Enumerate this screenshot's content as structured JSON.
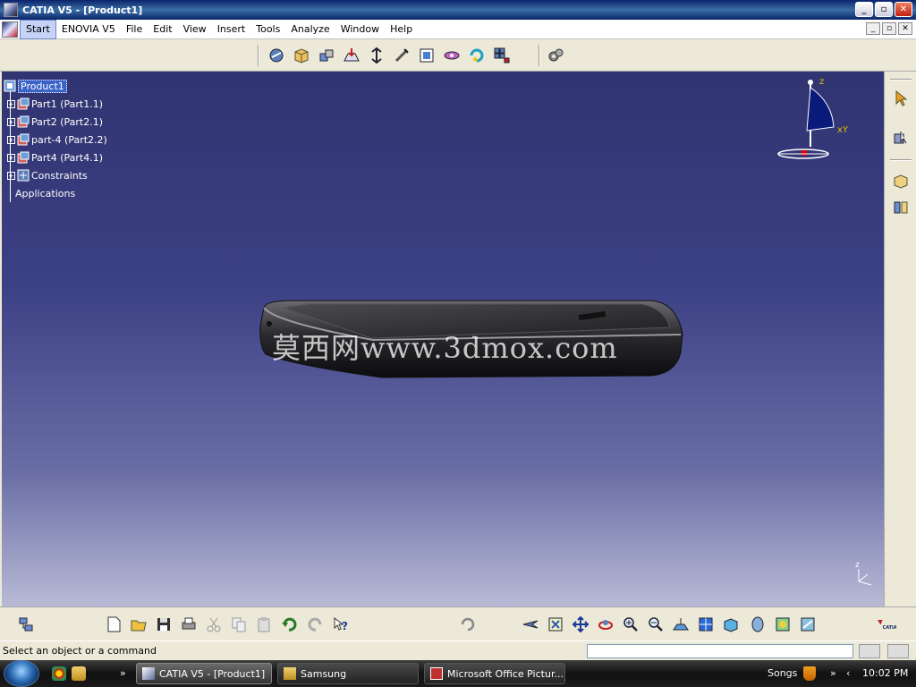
{
  "window": {
    "title": "CATIA V5 - [Product1]"
  },
  "menu": {
    "items": [
      {
        "label": "Start",
        "active": true
      },
      {
        "label": "ENOVIA V5"
      },
      {
        "label": "File"
      },
      {
        "label": "Edit"
      },
      {
        "label": "View"
      },
      {
        "label": "Insert"
      },
      {
        "label": "Tools"
      },
      {
        "label": "Analyze"
      },
      {
        "label": "Window"
      },
      {
        "label": "Help"
      }
    ]
  },
  "tree": {
    "root": "Product1",
    "items": [
      {
        "label": "Part1 (Part1.1)"
      },
      {
        "label": "Part2 (Part2.1)"
      },
      {
        "label": "part-4 (Part2.2)"
      },
      {
        "label": "Part4 (Part4.1)"
      },
      {
        "label": "Constraints"
      },
      {
        "label": "Applications"
      }
    ]
  },
  "viewport": {
    "watermark": "莫西网www.3dmox.com",
    "compass_labels": {
      "z": "z",
      "xy": "xY"
    },
    "mini_axis_label": "z"
  },
  "status": {
    "message": "Select an object or a command",
    "command_value": ""
  },
  "taskbar": {
    "tasks": [
      {
        "label": "CATIA V5 - [Product1]",
        "active": true
      },
      {
        "label": "Samsung"
      },
      {
        "label": "Microsoft Office Pictur..."
      }
    ],
    "tray_label": "Songs",
    "clock": "10:02 PM"
  },
  "colors": {
    "viewport_top": "#303470",
    "viewport_bottom": "#b8bad6",
    "selection": "#3a63c8"
  }
}
